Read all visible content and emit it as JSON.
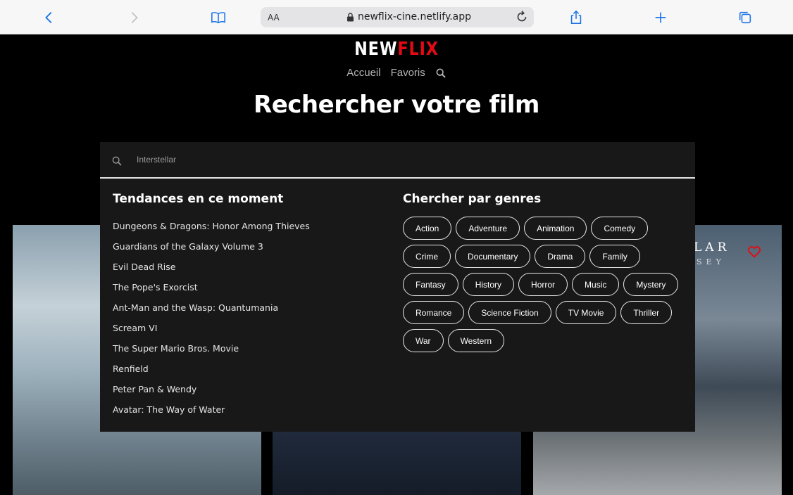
{
  "browser": {
    "text_size_label": "AA",
    "url": "newflix-cine.netlify.app",
    "icons": [
      "back-icon",
      "forward-icon",
      "bookmarks-icon",
      "lock-icon",
      "reload-icon",
      "share-icon",
      "new-tab-icon",
      "tabs-icon"
    ]
  },
  "site": {
    "logo_part1": "NEW",
    "logo_part2": "FLIX",
    "brand_color": "#e50914",
    "nav": {
      "home": "Accueil",
      "favorites": "Favoris"
    },
    "page_title": "Rechercher votre film"
  },
  "search": {
    "placeholder": "Interstellar",
    "value": ""
  },
  "trending": {
    "title": "Tendances en ce moment",
    "items": [
      "Dungeons & Dragons: Honor Among Thieves",
      "Guardians of the Galaxy Volume 3",
      "Evil Dead Rise",
      "The Pope's Exorcist",
      "Ant-Man and the Wasp: Quantumania",
      "Scream VI",
      "The Super Mario Bros. Movie",
      "Renfield",
      "Peter Pan & Wendy",
      "Avatar: The Way of Water"
    ]
  },
  "genres": {
    "title": "Chercher par genres",
    "items": [
      "Action",
      "Adventure",
      "Animation",
      "Comedy",
      "Crime",
      "Documentary",
      "Drama",
      "Family",
      "Fantasy",
      "History",
      "Horror",
      "Music",
      "Mystery",
      "Romance",
      "Science Fiction",
      "TV Movie",
      "Thriller",
      "War",
      "Western"
    ]
  },
  "posters": {
    "third_title": "LAR",
    "third_subtitle": "SEY"
  }
}
